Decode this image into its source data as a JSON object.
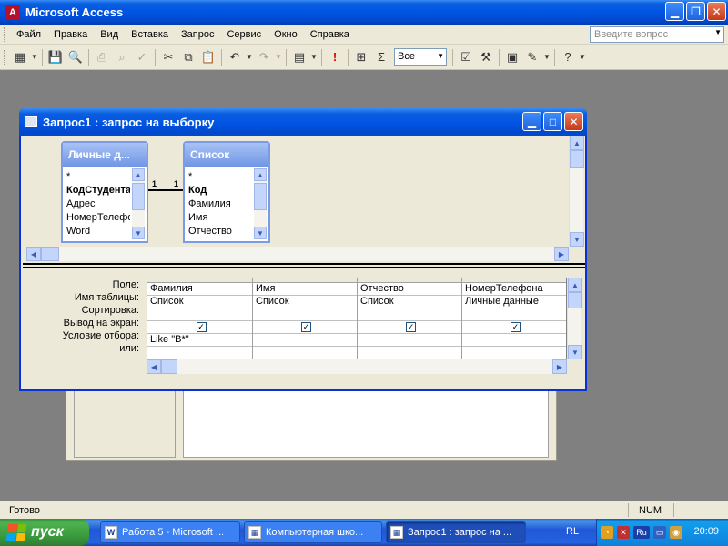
{
  "app": {
    "title": "Microsoft Access",
    "logo_letter": "A"
  },
  "menu": {
    "items": [
      "Файл",
      "Правка",
      "Вид",
      "Вставка",
      "Запрос",
      "Сервис",
      "Окно",
      "Справка"
    ],
    "ask_placeholder": "Введите вопрос"
  },
  "toolbar": {
    "combo_value": "Все"
  },
  "query_window": {
    "title": "Запрос1 : запрос на выборку",
    "tables": [
      {
        "name": "Личные д...",
        "fields": [
          "*",
          "КодСтудента",
          "Адрес",
          "НомерТелефона",
          "Word"
        ],
        "bold_index": 1
      },
      {
        "name": "Список",
        "fields": [
          "*",
          "Код",
          "Фамилия",
          "Имя",
          "Отчество"
        ],
        "bold_index": 1
      }
    ],
    "relation": {
      "left_label": "1",
      "right_label": "1"
    },
    "row_labels": [
      "Поле:",
      "Имя таблицы:",
      "Сортировка:",
      "Вывод на экран:",
      "Условие отбора:",
      "или:"
    ],
    "columns": [
      {
        "field": "Фамилия",
        "table": "Список",
        "sort": "",
        "show": true,
        "criteria": "Like \"В*\"",
        "or": ""
      },
      {
        "field": "Имя",
        "table": "Список",
        "sort": "",
        "show": true,
        "criteria": "",
        "or": ""
      },
      {
        "field": "Отчество",
        "table": "Список",
        "sort": "",
        "show": true,
        "criteria": "",
        "or": ""
      },
      {
        "field": "НомерТелефона",
        "table": "Личные данные",
        "sort": "",
        "show": true,
        "criteria": "",
        "or": ""
      }
    ]
  },
  "status": {
    "left": "Готово",
    "num": "NUM"
  },
  "taskbar": {
    "start_label": "пуск",
    "tasks": [
      {
        "label": "Работа 5 - Microsoft ...",
        "icon": "W",
        "active": false
      },
      {
        "label": "Компьютерная шко...",
        "icon": "▦",
        "active": false
      },
      {
        "label": "Запрос1 : запрос на ...",
        "icon": "▦",
        "active": true
      }
    ],
    "lang": "RL",
    "tray_lang": "Ru",
    "clock": "20:09"
  },
  "colors": {
    "xp_blue": "#0054e3",
    "start_green": "#3c9c3e",
    "access_red": "#b3112b"
  }
}
